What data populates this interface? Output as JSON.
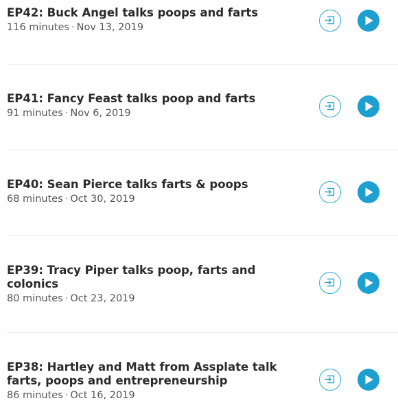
{
  "episodes": [
    {
      "title": "EP42: Buck Angel talks poops and farts",
      "duration": "116 minutes",
      "separator": "·",
      "date": "Nov 13, 2019",
      "queue_icon": "add-to-queue-icon",
      "play_icon": "play-icon"
    },
    {
      "title": "EP41: Fancy Feast talks poop and farts",
      "duration": "91 minutes",
      "separator": "·",
      "date": "Nov 6, 2019",
      "queue_icon": "add-to-queue-icon",
      "play_icon": "play-icon"
    },
    {
      "title": "EP40: Sean Pierce talks farts & poops",
      "duration": "68 minutes",
      "separator": "·",
      "date": "Oct 30, 2019",
      "queue_icon": "add-to-queue-icon",
      "play_icon": "play-icon"
    },
    {
      "title": "EP39: Tracy Piper talks poop, farts and colonics",
      "duration": "80 minutes",
      "separator": "·",
      "date": "Oct 23, 2019",
      "queue_icon": "add-to-queue-icon",
      "play_icon": "play-icon"
    },
    {
      "title": "EP38: Hartley and Matt from Assplate talk farts, poops and entrepreneurship",
      "duration": "86 minutes",
      "separator": "·",
      "date": "Oct 16, 2019",
      "queue_icon": "add-to-queue-icon",
      "play_icon": "play-icon"
    }
  ],
  "colors": {
    "accent": "#1d9fd0",
    "queue_outline": "#2aa8cf",
    "title_text": "#2b2b2b",
    "meta_text": "#555555",
    "divider": "#e9e9e9"
  }
}
